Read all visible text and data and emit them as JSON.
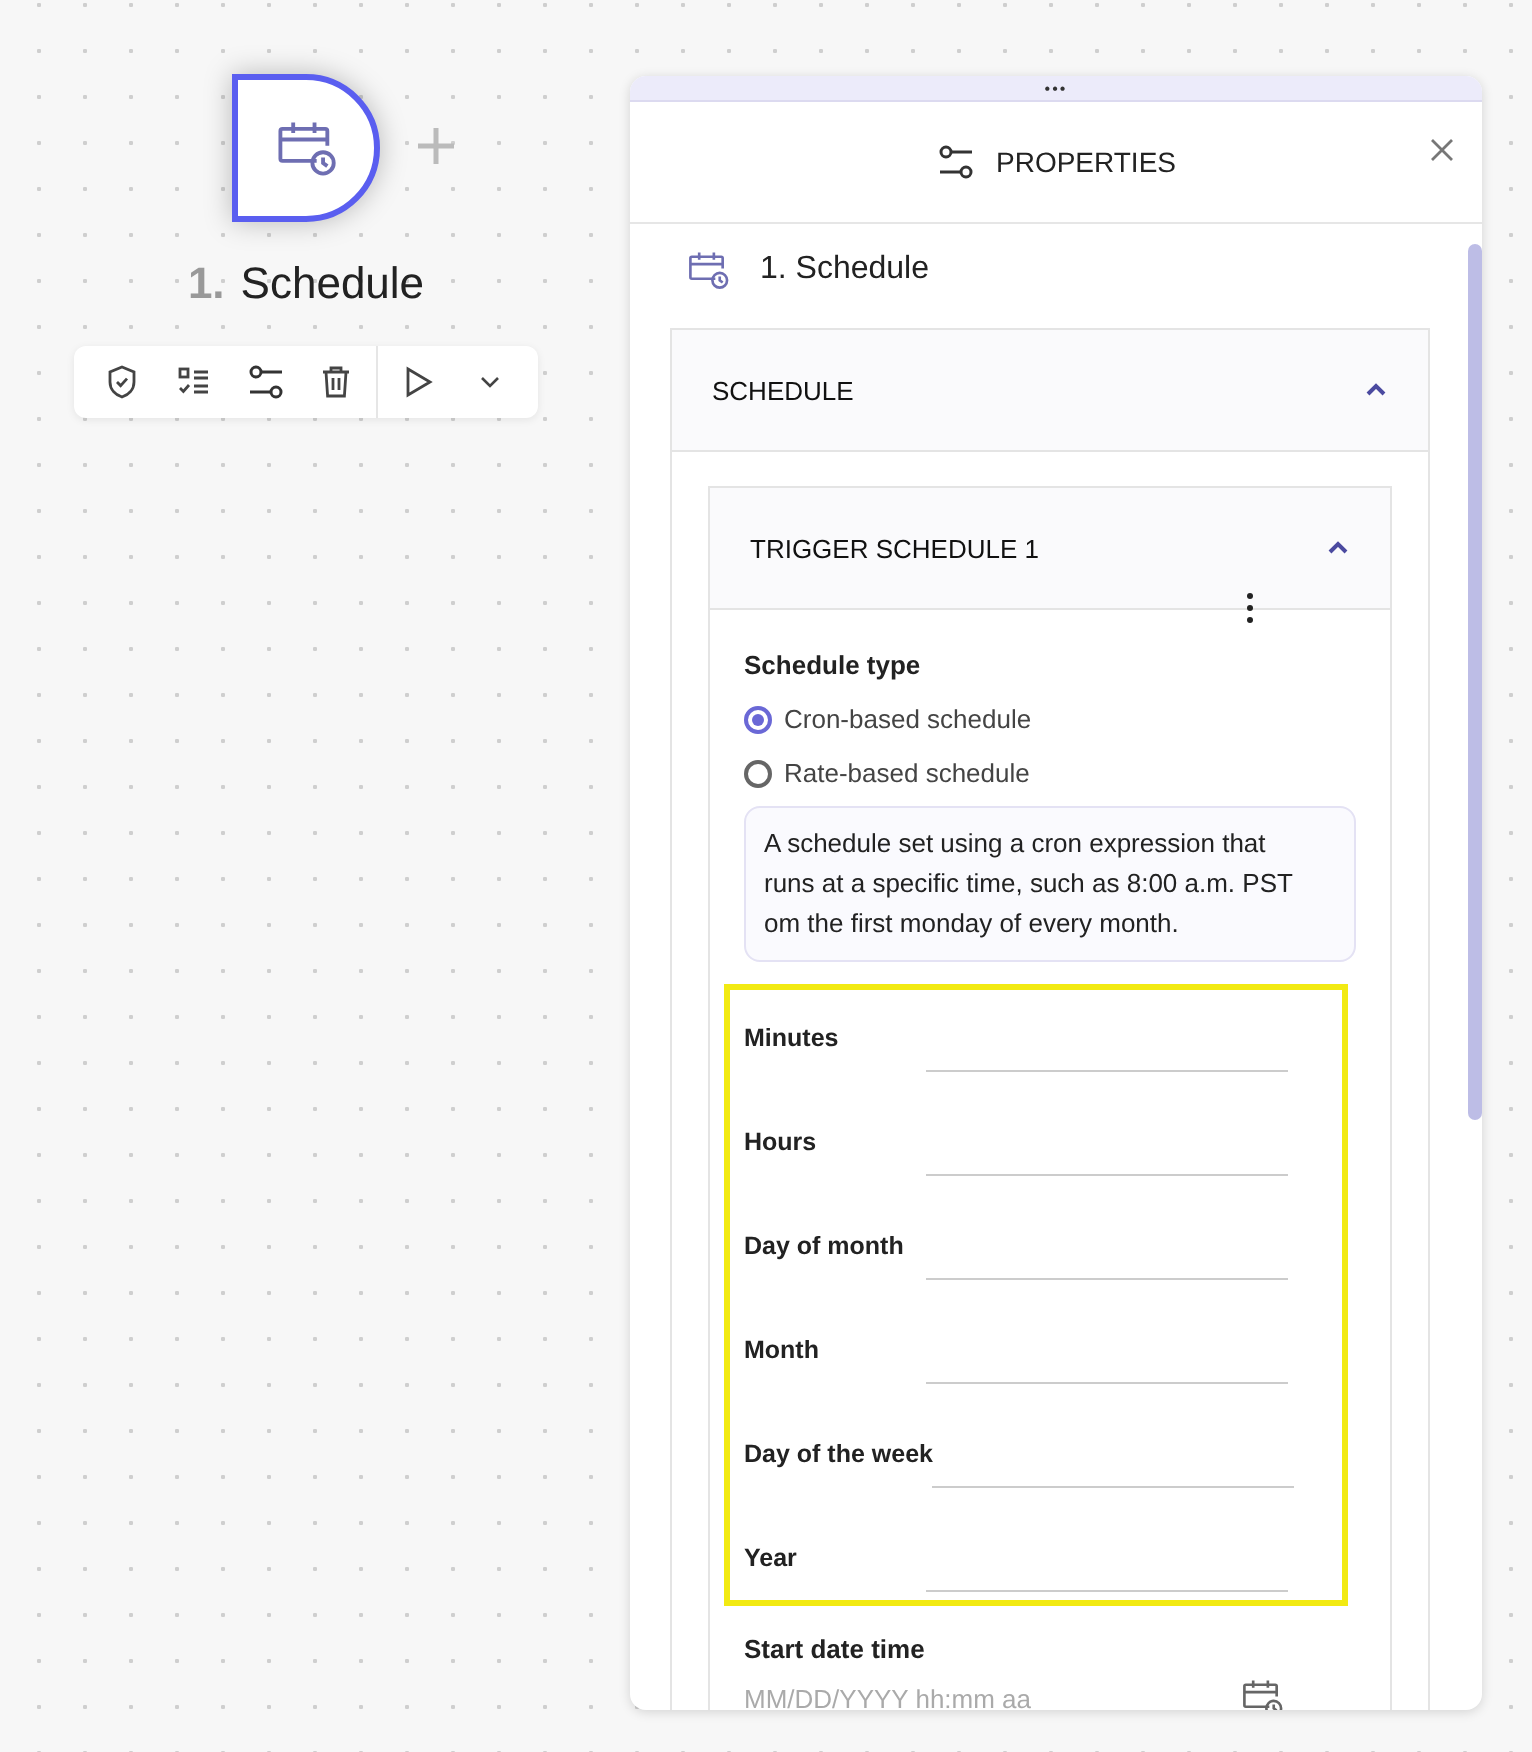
{
  "node": {
    "number": "1.",
    "title": "Schedule"
  },
  "panel": {
    "handle": "•••",
    "title": "PROPERTIES",
    "step_title": "1. Schedule",
    "section": {
      "title": "SCHEDULE",
      "expanded": true,
      "trigger": {
        "title": "TRIGGER SCHEDULE 1",
        "expanded": true,
        "schedule_type_label": "Schedule type",
        "options": [
          {
            "label": "Cron-based schedule",
            "selected": true
          },
          {
            "label": "Rate-based schedule",
            "selected": false
          }
        ],
        "description": "A schedule set using a cron expression that runs at a specific time, such as 8:00 a.m. PST om the first monday of every month.",
        "fields": [
          {
            "label": "Minutes"
          },
          {
            "label": "Hours"
          },
          {
            "label": "Day of month"
          },
          {
            "label": "Month"
          },
          {
            "label": "Day of the week"
          },
          {
            "label": "Year"
          }
        ],
        "start_date": {
          "label": "Start date time",
          "placeholder": "MM/DD/YYYY hh:mm aa"
        }
      }
    }
  }
}
